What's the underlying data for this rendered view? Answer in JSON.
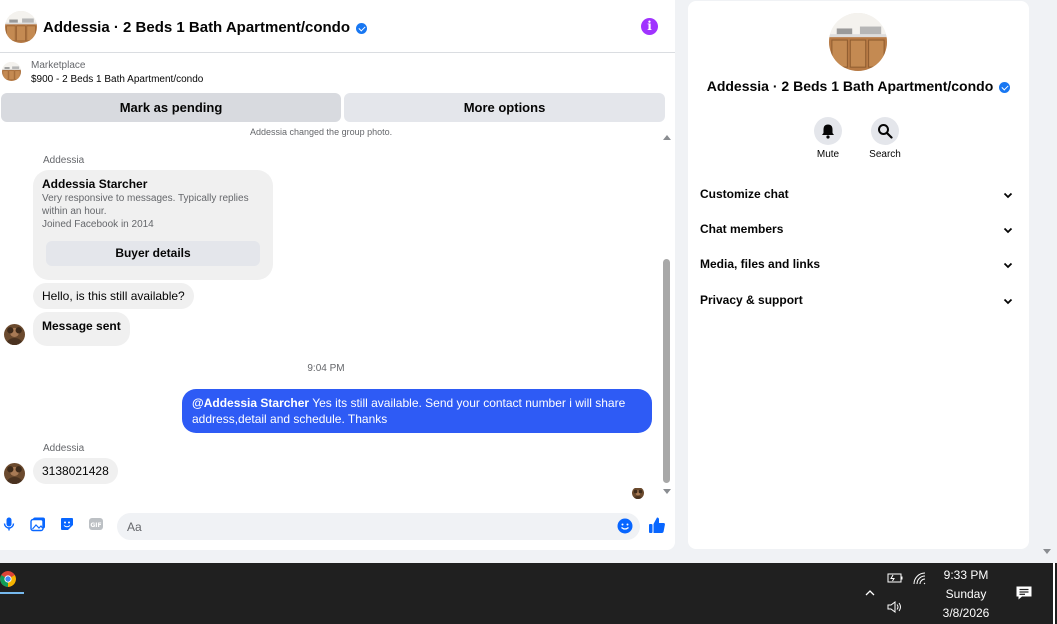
{
  "chat": {
    "title": "Addessia · 2 Beds 1 Bath Apartment/condo",
    "marketplace_label": "Marketplace",
    "listing": "$900 - 2 Beds 1 Bath Apartment/condo",
    "mark_pending_label": "Mark as pending",
    "more_options_label": "More options"
  },
  "messages": {
    "system_note": "Addessia changed the group photo.",
    "sender_1": "Addessia",
    "card_name": "Addessia Starcher",
    "card_desc": "Very responsive to messages. Typically replies within an hour.",
    "card_joined": "Joined Facebook in 2014",
    "card_button": "Buyer details",
    "msg_1": "Hello, is this still available?",
    "msg_2": "Message sent",
    "time": "9:04 PM",
    "out_mention": "@Addessia Starcher",
    "out_text": " Yes its still available. Send your contact number i will share address,detail and schedule. Thanks",
    "sender_2": "Addessia",
    "msg_3": "3138021428"
  },
  "composer": {
    "placeholder": "Aa"
  },
  "panel": {
    "title": "Addessia · 2 Beds 1 Bath Apartment/condo",
    "mute_label": "Mute",
    "search_label": "Search",
    "sections": [
      "Customize chat",
      "Chat members",
      "Media, files and links",
      "Privacy & support"
    ]
  },
  "taskbar": {
    "time": "9:33 PM",
    "day": "Sunday",
    "date": "3/8/2026"
  },
  "colors": {
    "accent": "#1877f2",
    "outgoing_bubble": "#2e5bf5",
    "info_icon": "#a033ff"
  },
  "icons": [
    "info-icon",
    "verified-icon",
    "mic-icon",
    "photo-icon",
    "sticker-icon",
    "gif-icon",
    "emoji-icon",
    "like-icon",
    "bell-icon",
    "search-icon",
    "chevron-down-icon",
    "battery-icon",
    "wifi-icon",
    "volume-icon",
    "notification-icon",
    "chrome-icon"
  ]
}
